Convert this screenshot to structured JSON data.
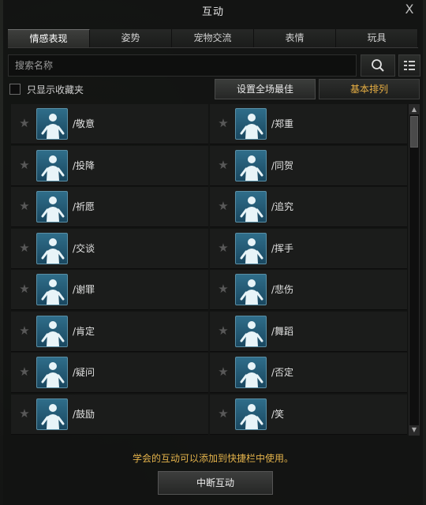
{
  "window": {
    "title": "互动",
    "close_symbol": "X"
  },
  "tabs": [
    {
      "label": "情感表现",
      "active": true
    },
    {
      "label": "姿势",
      "active": false
    },
    {
      "label": "宠物交流",
      "active": false
    },
    {
      "label": "表情",
      "active": false
    },
    {
      "label": "玩具",
      "active": false
    }
  ],
  "search": {
    "placeholder": "搜索名称",
    "value": ""
  },
  "filter": {
    "show_favorites_label": "只显示收藏夹",
    "checked": false
  },
  "buttons": {
    "set_best": "设置全场最佳",
    "sort": "基本排列",
    "stop": "中断互动"
  },
  "emotes": [
    {
      "name": "/敬意",
      "icon": "bow-icon"
    },
    {
      "name": "/郑重",
      "icon": "solemn-icon"
    },
    {
      "name": "/投降",
      "icon": "surrender-icon"
    },
    {
      "name": "/同贺",
      "icon": "celebrate-icon"
    },
    {
      "name": "/祈愿",
      "icon": "pray-icon"
    },
    {
      "name": "/追究",
      "icon": "question-accuse-icon"
    },
    {
      "name": "/交谈",
      "icon": "talk-icon"
    },
    {
      "name": "/挥手",
      "icon": "wave-icon"
    },
    {
      "name": "/谢罪",
      "icon": "apologize-icon"
    },
    {
      "name": "/悲伤",
      "icon": "sad-icon"
    },
    {
      "name": "/肯定",
      "icon": "affirm-icon"
    },
    {
      "name": "/舞蹈",
      "icon": "dance-icon"
    },
    {
      "name": "/疑问",
      "icon": "doubt-icon"
    },
    {
      "name": "/否定",
      "icon": "deny-icon"
    },
    {
      "name": "/鼓励",
      "icon": "encourage-icon"
    },
    {
      "name": "/笑",
      "icon": "laugh-icon"
    }
  ],
  "footer": {
    "hint": "学会的互动可以添加到快捷栏中使用。"
  },
  "colors": {
    "accent": "#e4b34b",
    "icon_bg": "#2f6e8a"
  }
}
